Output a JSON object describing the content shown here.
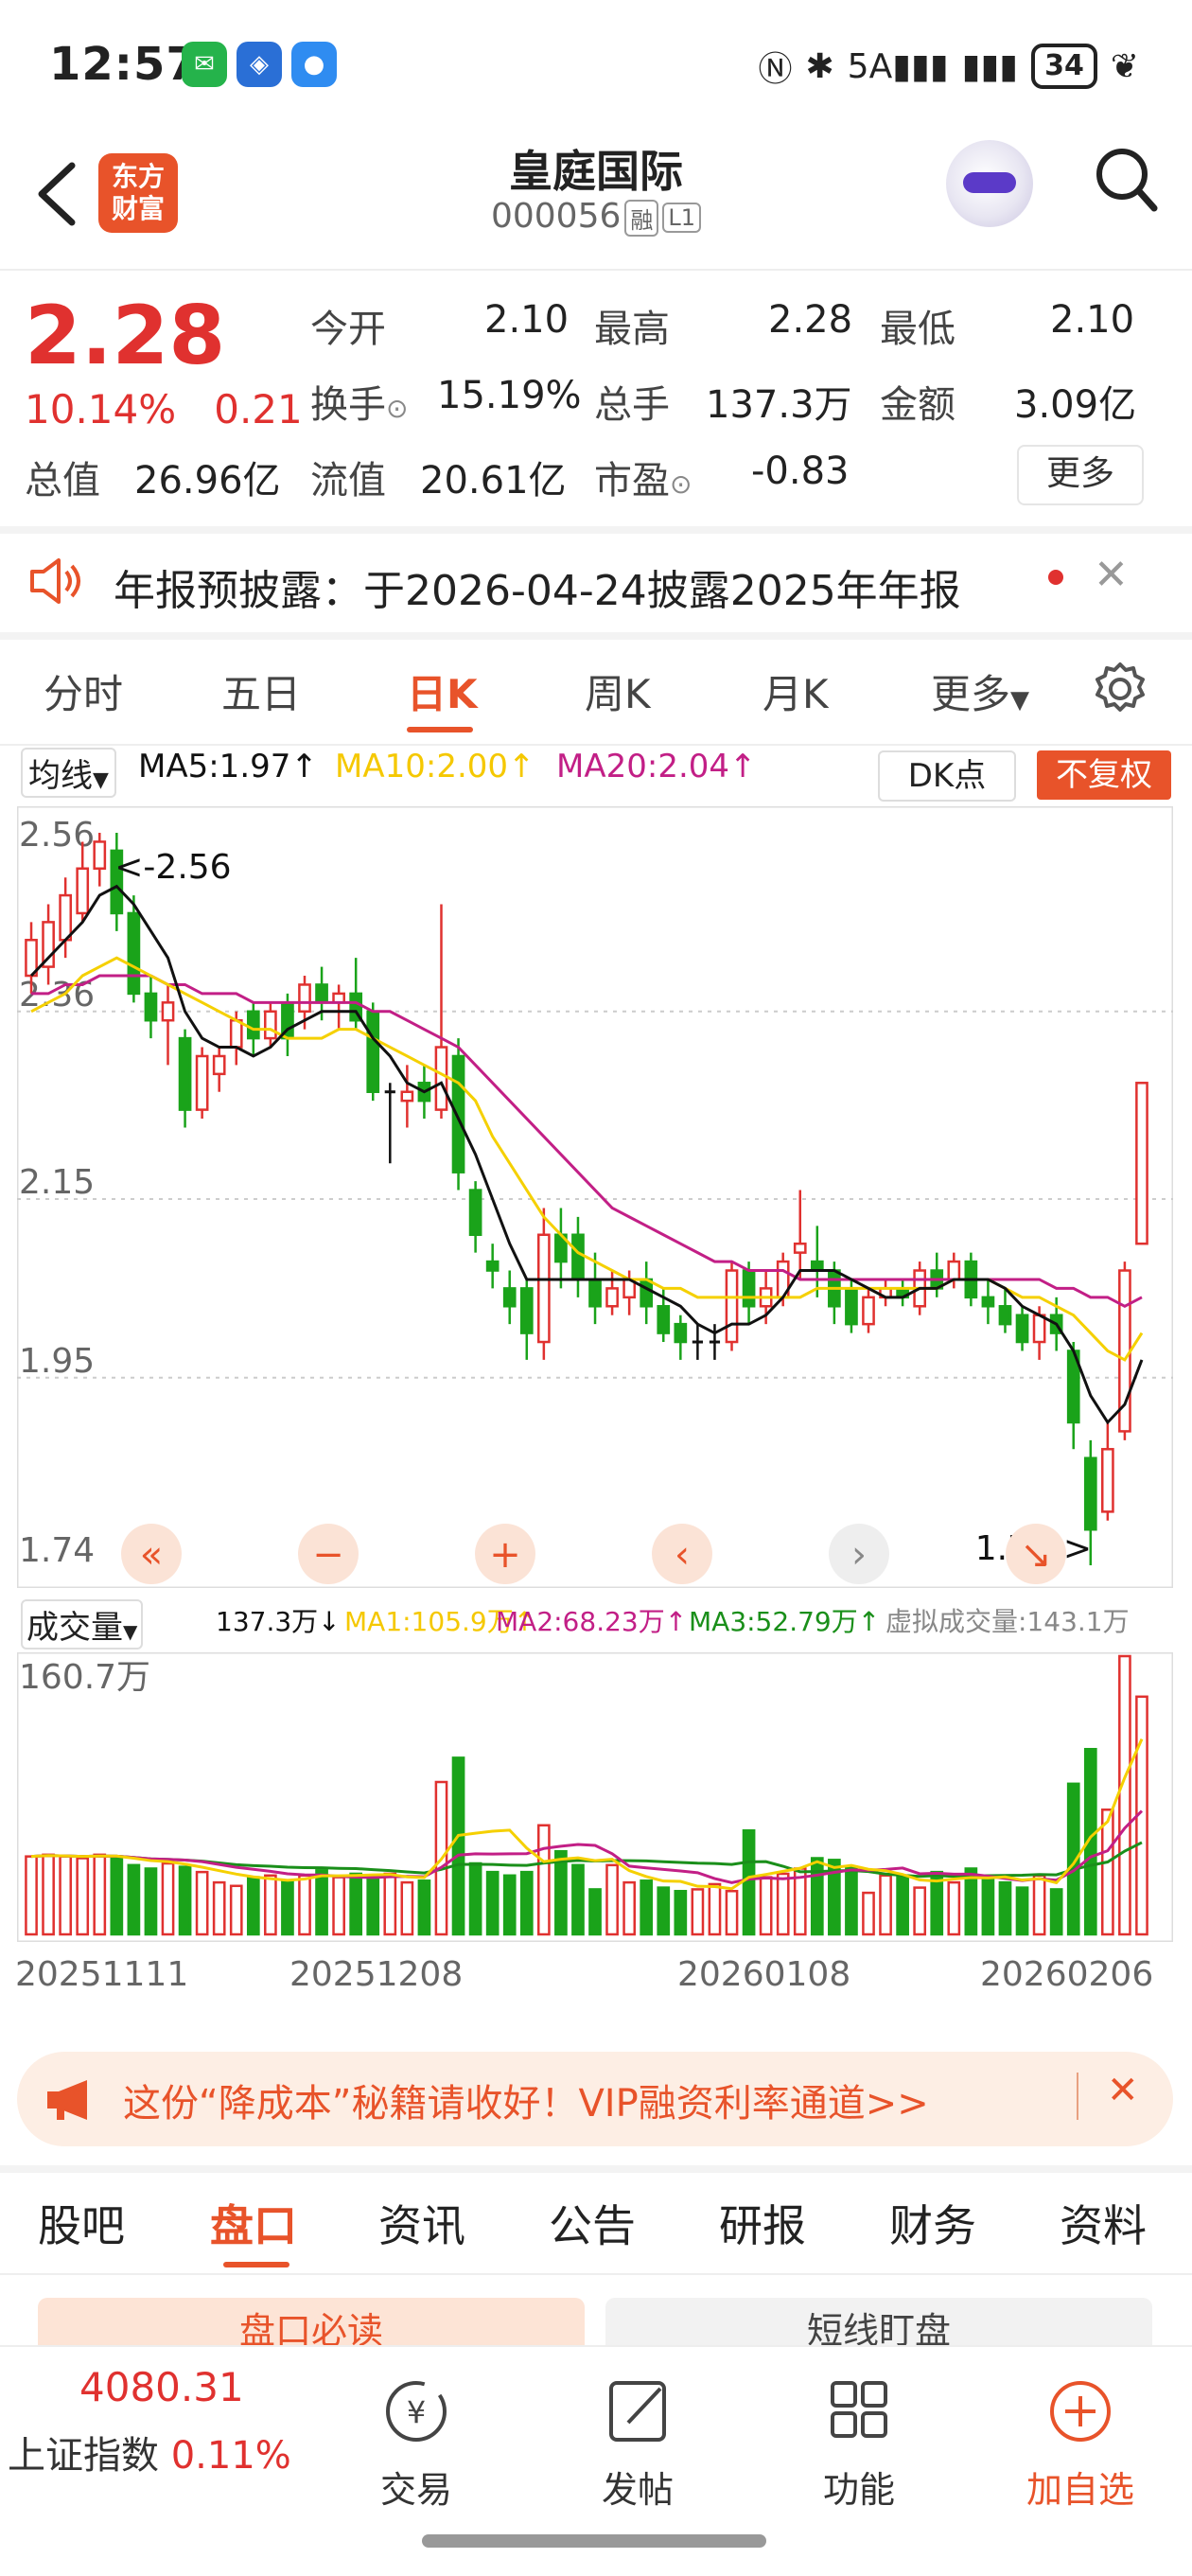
{
  "status_bar": {
    "time": "12:57",
    "network": "5A",
    "battery": "34",
    "apps": [
      "微",
      "广",
      "信"
    ]
  },
  "header": {
    "title": "皇庭国际",
    "code": "000056",
    "tag_margin": "融",
    "tag_level": "L1",
    "logo_line1": "东方",
    "logo_line2": "财富"
  },
  "quote": {
    "price": "2.28",
    "change_pct": "10.14%",
    "change_abs": "0.21",
    "fields": [
      {
        "label": "今开",
        "value": "2.10",
        "color": "red"
      },
      {
        "label": "最高",
        "value": "2.28",
        "color": "red"
      },
      {
        "label": "最低",
        "value": "2.10",
        "color": "red"
      },
      {
        "label": "换手",
        "value": "15.19%",
        "color": "dark"
      },
      {
        "label": "总手",
        "value": "137.3万",
        "color": "dark"
      },
      {
        "label": "金额",
        "value": "3.09亿",
        "color": "dark"
      },
      {
        "label": "总值",
        "value": "26.96亿",
        "color": "dark"
      },
      {
        "label": "流值",
        "value": "20.61亿",
        "color": "dark"
      },
      {
        "label": "市盈",
        "value": "-0.83",
        "color": "dark"
      }
    ],
    "more_label": "更多"
  },
  "notice": {
    "text": "年报预披露：于2026-04-24披露2025年年报"
  },
  "chart_tabs": [
    "分时",
    "五日",
    "日K",
    "周K",
    "月K",
    "更多"
  ],
  "ma_bar": {
    "selector": "均线",
    "ma5": "MA5:1.97",
    "ma10": "MA10:2.00",
    "ma20": "MA20:2.04",
    "dk": "DK点",
    "fq": "不复权"
  },
  "colors": {
    "accent": "#e8532a",
    "up": "#e0312f",
    "down": "#1aa31a",
    "ma5": "#111111",
    "ma10": "#f5d000",
    "ma20": "#c21f86",
    "vma3": "#1a8f1a"
  },
  "chart_data": [
    {
      "type": "candlestick",
      "y_ticks": [
        "2.56",
        "2.36",
        "2.15",
        "1.95",
        "1.74"
      ],
      "ylim": [
        1.74,
        2.56
      ],
      "max_label": "<-2.56",
      "min_label": "1.74->",
      "grid": true,
      "candles": [
        {
          "o": 2.4,
          "c": 2.44,
          "h": 2.46,
          "l": 2.38
        },
        {
          "o": 2.41,
          "c": 2.46,
          "h": 2.48,
          "l": 2.39
        },
        {
          "o": 2.44,
          "c": 2.49,
          "h": 2.51,
          "l": 2.42
        },
        {
          "o": 2.47,
          "c": 2.52,
          "h": 2.55,
          "l": 2.46
        },
        {
          "o": 2.52,
          "c": 2.55,
          "h": 2.56,
          "l": 2.5
        },
        {
          "o": 2.54,
          "c": 2.47,
          "h": 2.56,
          "l": 2.45
        },
        {
          "o": 2.47,
          "c": 2.38,
          "h": 2.49,
          "l": 2.37
        },
        {
          "o": 2.38,
          "c": 2.35,
          "h": 2.4,
          "l": 2.33
        },
        {
          "o": 2.35,
          "c": 2.37,
          "h": 2.39,
          "l": 2.3
        },
        {
          "o": 2.33,
          "c": 2.25,
          "h": 2.34,
          "l": 2.23
        },
        {
          "o": 2.25,
          "c": 2.31,
          "h": 2.32,
          "l": 2.24
        },
        {
          "o": 2.29,
          "c": 2.31,
          "h": 2.32,
          "l": 2.27
        },
        {
          "o": 2.32,
          "c": 2.35,
          "h": 2.36,
          "l": 2.3
        },
        {
          "o": 2.36,
          "c": 2.33,
          "h": 2.37,
          "l": 2.31
        },
        {
          "o": 2.33,
          "c": 2.36,
          "h": 2.37,
          "l": 2.32
        },
        {
          "o": 2.37,
          "c": 2.33,
          "h": 2.38,
          "l": 2.31
        },
        {
          "o": 2.36,
          "c": 2.39,
          "h": 2.4,
          "l": 2.34
        },
        {
          "o": 2.39,
          "c": 2.37,
          "h": 2.41,
          "l": 2.35
        },
        {
          "o": 2.37,
          "c": 2.38,
          "h": 2.39,
          "l": 2.34
        },
        {
          "o": 2.38,
          "c": 2.35,
          "h": 2.42,
          "l": 2.34
        },
        {
          "o": 2.36,
          "c": 2.27,
          "h": 2.37,
          "l": 2.26
        },
        {
          "o": 2.27,
          "c": 2.27,
          "h": 2.28,
          "l": 2.19
        },
        {
          "o": 2.26,
          "c": 2.27,
          "h": 2.3,
          "l": 2.23
        },
        {
          "o": 2.28,
          "c": 2.26,
          "h": 2.3,
          "l": 2.24
        },
        {
          "o": 2.25,
          "c": 2.32,
          "h": 2.48,
          "l": 2.24
        },
        {
          "o": 2.31,
          "c": 2.18,
          "h": 2.33,
          "l": 2.16
        },
        {
          "o": 2.16,
          "c": 2.11,
          "h": 2.17,
          "l": 2.09
        },
        {
          "o": 2.08,
          "c": 2.07,
          "h": 2.1,
          "l": 2.05
        },
        {
          "o": 2.05,
          "c": 2.03,
          "h": 2.07,
          "l": 2.01
        },
        {
          "o": 2.05,
          "c": 2.0,
          "h": 2.06,
          "l": 1.97
        },
        {
          "o": 1.99,
          "c": 2.11,
          "h": 2.14,
          "l": 1.97
        },
        {
          "o": 2.11,
          "c": 2.08,
          "h": 2.14,
          "l": 2.05
        },
        {
          "o": 2.11,
          "c": 2.06,
          "h": 2.13,
          "l": 2.04
        },
        {
          "o": 2.06,
          "c": 2.03,
          "h": 2.09,
          "l": 2.01
        },
        {
          "o": 2.03,
          "c": 2.05,
          "h": 2.07,
          "l": 2.02
        },
        {
          "o": 2.04,
          "c": 2.06,
          "h": 2.07,
          "l": 2.02
        },
        {
          "o": 2.06,
          "c": 2.03,
          "h": 2.08,
          "l": 2.01
        },
        {
          "o": 2.03,
          "c": 2.0,
          "h": 2.05,
          "l": 1.99
        },
        {
          "o": 2.01,
          "c": 1.99,
          "h": 2.02,
          "l": 1.97
        },
        {
          "o": 1.99,
          "c": 1.99,
          "h": 2.01,
          "l": 1.97
        },
        {
          "o": 1.99,
          "c": 1.99,
          "h": 2.01,
          "l": 1.97
        },
        {
          "o": 1.99,
          "c": 2.07,
          "h": 2.08,
          "l": 1.98
        },
        {
          "o": 2.07,
          "c": 2.03,
          "h": 2.08,
          "l": 2.01
        },
        {
          "o": 2.03,
          "c": 2.05,
          "h": 2.07,
          "l": 2.01
        },
        {
          "o": 2.04,
          "c": 2.08,
          "h": 2.09,
          "l": 2.03
        },
        {
          "o": 2.09,
          "c": 2.1,
          "h": 2.16,
          "l": 2.06
        },
        {
          "o": 2.08,
          "c": 2.07,
          "h": 2.12,
          "l": 2.04
        },
        {
          "o": 2.07,
          "c": 2.03,
          "h": 2.08,
          "l": 2.01
        },
        {
          "o": 2.05,
          "c": 2.01,
          "h": 2.06,
          "l": 2.0
        },
        {
          "o": 2.01,
          "c": 2.04,
          "h": 2.05,
          "l": 2.0
        },
        {
          "o": 2.04,
          "c": 2.05,
          "h": 2.06,
          "l": 2.03
        },
        {
          "o": 2.05,
          "c": 2.04,
          "h": 2.06,
          "l": 2.03
        },
        {
          "o": 2.03,
          "c": 2.07,
          "h": 2.08,
          "l": 2.02
        },
        {
          "o": 2.07,
          "c": 2.05,
          "h": 2.09,
          "l": 2.04
        },
        {
          "o": 2.06,
          "c": 2.08,
          "h": 2.09,
          "l": 2.05
        },
        {
          "o": 2.08,
          "c": 2.04,
          "h": 2.09,
          "l": 2.03
        },
        {
          "o": 2.04,
          "c": 2.03,
          "h": 2.06,
          "l": 2.01
        },
        {
          "o": 2.03,
          "c": 2.01,
          "h": 2.05,
          "l": 2.0
        },
        {
          "o": 2.02,
          "c": 1.99,
          "h": 2.03,
          "l": 1.98
        },
        {
          "o": 1.99,
          "c": 2.02,
          "h": 2.03,
          "l": 1.97
        },
        {
          "o": 2.02,
          "c": 2.0,
          "h": 2.04,
          "l": 1.98
        },
        {
          "o": 1.98,
          "c": 1.9,
          "h": 1.99,
          "l": 1.87
        },
        {
          "o": 1.86,
          "c": 1.78,
          "h": 1.88,
          "l": 1.74
        },
        {
          "o": 1.8,
          "c": 1.87,
          "h": 1.9,
          "l": 1.79
        },
        {
          "o": 1.89,
          "c": 2.07,
          "h": 2.08,
          "l": 1.88
        },
        {
          "o": 2.1,
          "c": 2.28,
          "h": 2.28,
          "l": 2.1
        }
      ],
      "ma5": [
        2.4,
        2.42,
        2.44,
        2.46,
        2.49,
        2.5,
        2.48,
        2.45,
        2.42,
        2.36,
        2.33,
        2.32,
        2.32,
        2.31,
        2.32,
        2.34,
        2.35,
        2.36,
        2.36,
        2.36,
        2.33,
        2.31,
        2.28,
        2.27,
        2.28,
        2.24,
        2.2,
        2.15,
        2.1,
        2.06,
        2.06,
        2.06,
        2.06,
        2.06,
        2.06,
        2.06,
        2.05,
        2.04,
        2.03,
        2.01,
        2.0,
        2.01,
        2.01,
        2.02,
        2.04,
        2.07,
        2.07,
        2.07,
        2.06,
        2.05,
        2.04,
        2.04,
        2.05,
        2.05,
        2.06,
        2.06,
        2.06,
        2.05,
        2.03,
        2.02,
        2.01,
        1.98,
        1.93,
        1.9,
        1.92,
        1.97
      ],
      "ma10": [
        2.36,
        2.37,
        2.38,
        2.4,
        2.41,
        2.42,
        2.41,
        2.4,
        2.39,
        2.38,
        2.37,
        2.36,
        2.35,
        2.34,
        2.34,
        2.33,
        2.33,
        2.33,
        2.34,
        2.34,
        2.33,
        2.32,
        2.31,
        2.3,
        2.29,
        2.28,
        2.26,
        2.22,
        2.19,
        2.16,
        2.13,
        2.11,
        2.09,
        2.08,
        2.07,
        2.06,
        2.06,
        2.05,
        2.05,
        2.04,
        2.04,
        2.04,
        2.04,
        2.04,
        2.04,
        2.04,
        2.05,
        2.05,
        2.05,
        2.05,
        2.05,
        2.05,
        2.05,
        2.05,
        2.06,
        2.06,
        2.06,
        2.05,
        2.04,
        2.04,
        2.03,
        2.02,
        2.0,
        1.98,
        1.97,
        2.0
      ],
      "ma20": [
        2.38,
        2.38,
        2.39,
        2.39,
        2.4,
        2.4,
        2.4,
        2.4,
        2.39,
        2.39,
        2.38,
        2.38,
        2.38,
        2.37,
        2.37,
        2.37,
        2.37,
        2.37,
        2.37,
        2.37,
        2.36,
        2.36,
        2.35,
        2.34,
        2.33,
        2.32,
        2.3,
        2.28,
        2.26,
        2.24,
        2.22,
        2.2,
        2.18,
        2.16,
        2.14,
        2.13,
        2.12,
        2.11,
        2.1,
        2.09,
        2.08,
        2.08,
        2.07,
        2.07,
        2.07,
        2.06,
        2.06,
        2.06,
        2.06,
        2.06,
        2.06,
        2.06,
        2.06,
        2.06,
        2.06,
        2.06,
        2.06,
        2.06,
        2.06,
        2.06,
        2.05,
        2.05,
        2.04,
        2.04,
        2.03,
        2.04
      ]
    },
    {
      "type": "bar",
      "y_top_label": "160.7万",
      "ylim": [
        0,
        160.7
      ],
      "x_ticks": [
        "20251111",
        "20251208",
        "20260108",
        "20260206"
      ],
      "volumes": [
        45,
        46,
        45,
        44,
        46,
        45,
        40,
        38,
        41,
        39,
        36,
        30,
        28,
        33,
        34,
        31,
        34,
        37,
        33,
        35,
        33,
        35,
        30,
        31,
        88,
        102,
        41,
        36,
        34,
        36,
        63,
        48,
        40,
        26,
        40,
        30,
        31,
        27,
        25,
        26,
        29,
        25,
        60,
        33,
        35,
        38,
        44,
        43,
        39,
        24,
        34,
        33,
        27,
        36,
        30,
        38,
        32,
        30,
        27,
        34,
        26,
        87,
        107,
        72,
        160.7,
        137.3
      ],
      "current": "137.3万",
      "ma1": "MA1:105.9万",
      "ma2": "MA2:68.23万",
      "ma3": "MA3:52.79万",
      "virtual": "虚拟成交量:143.1万",
      "selector": "成交量"
    }
  ],
  "ad": {
    "text": "这份“降成本”秘籍请收好！VIP融资利率通道>>"
  },
  "bottom_tabs": [
    "股吧",
    "盘口",
    "资讯",
    "公告",
    "研报",
    "财务",
    "资料"
  ],
  "pills": [
    "盘口必读",
    "短线盯盘"
  ],
  "bottom_nav": {
    "index_value": "4080.31",
    "index_name": "上证指数",
    "index_change": "0.11%",
    "items": [
      "交易",
      "发帖",
      "功能",
      "加自选"
    ]
  }
}
